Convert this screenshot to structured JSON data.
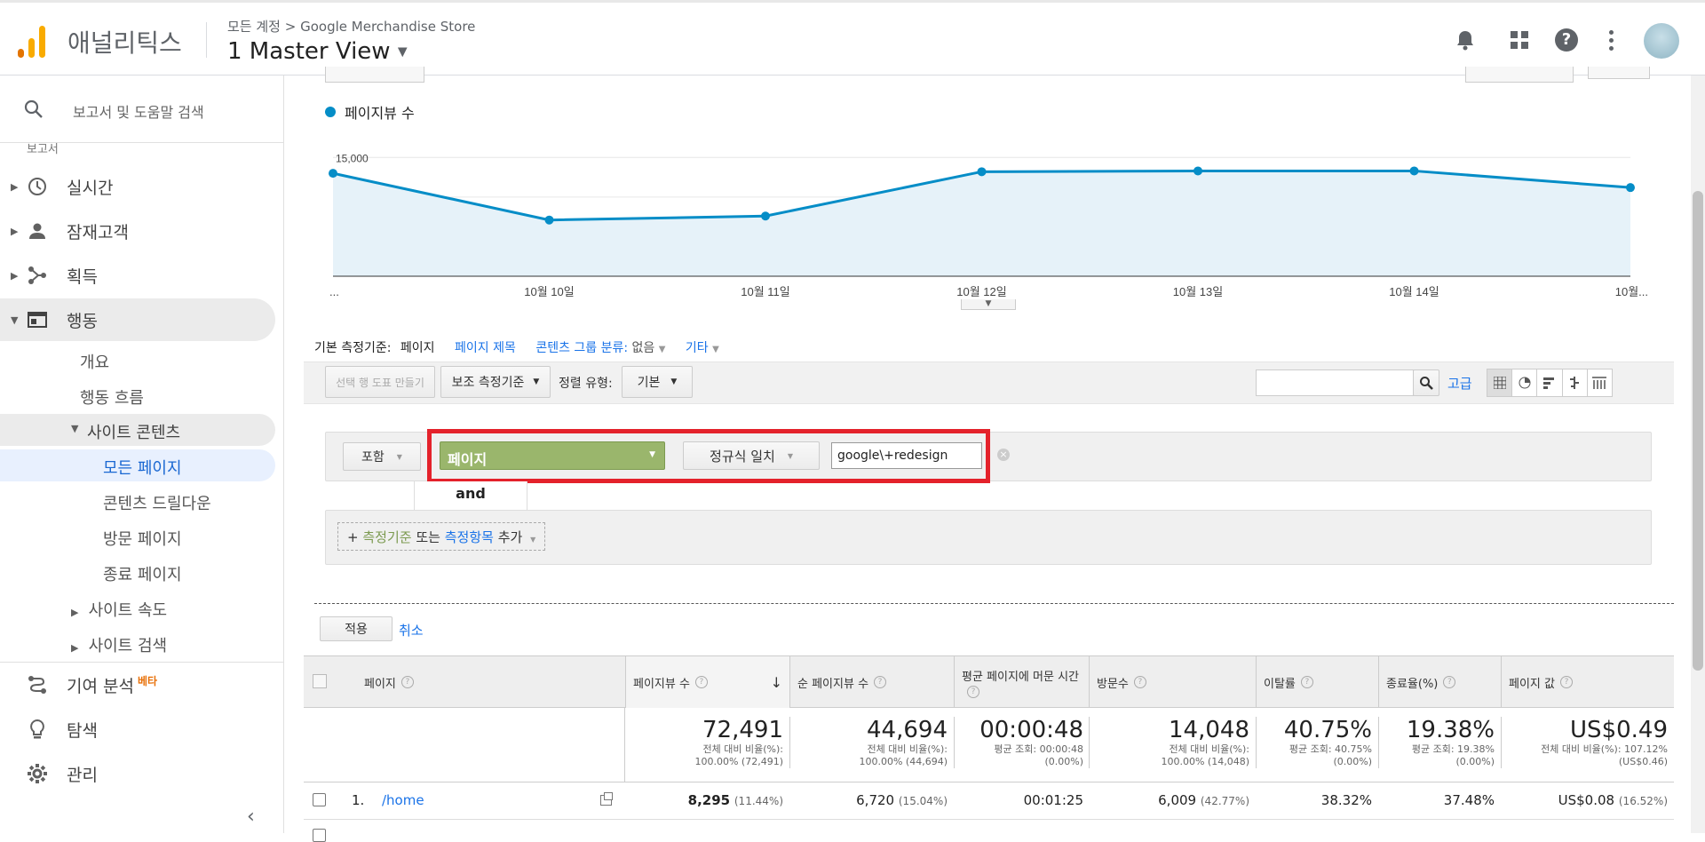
{
  "header": {
    "app_name": "애널리틱스",
    "breadcrumb_account": "모든 계정",
    "breadcrumb_separator": ">",
    "breadcrumb_property": "Google Merchandise Store",
    "view_name": "1 Master View"
  },
  "sidebar": {
    "search_placeholder": "보고서 및 도움말 검색",
    "section_label": "보고서",
    "items": [
      {
        "label": "실시간",
        "icon": "clock-icon"
      },
      {
        "label": "잠재고객",
        "icon": "person-icon"
      },
      {
        "label": "획득",
        "icon": "acquisition-icon"
      },
      {
        "label": "행동",
        "icon": "behavior-icon"
      }
    ],
    "behavior_sub": [
      "개요",
      "행동 흐름"
    ],
    "site_content": "사이트 콘텐츠",
    "site_content_sub": [
      "모든 페이지",
      "콘텐츠 드릴다운",
      "방문 페이지",
      "종료 페이지"
    ],
    "site_speed": "사이트 속도",
    "site_search": "사이트 검색",
    "attribution": "기여 분석",
    "attribution_badge": "베타",
    "discover": "탐색",
    "admin": "관리"
  },
  "chart": {
    "legend_label": "페이지뷰 수",
    "series_color": "#058dc7"
  },
  "chart_data": {
    "type": "line",
    "x": [
      "...",
      "10월 10일",
      "10월 11일",
      "10월 12일",
      "10월 13일",
      "10월 14일",
      "10월..."
    ],
    "series": [
      {
        "name": "페이지뷰 수",
        "values": [
          13000,
          7100,
          7600,
          13200,
          13300,
          13300,
          11200
        ]
      }
    ],
    "y_ticks": [
      "15,000",
      "10,000",
      "5,000"
    ],
    "ylim": [
      0,
      17500
    ]
  },
  "dimension_bar": {
    "label": "기본 측정기준:",
    "active": "페이지",
    "option_title": "페이지 제목",
    "option_group": "콘텐츠 그룹 분류:",
    "option_group_value": "없음",
    "option_other": "기타"
  },
  "toolbar": {
    "create_chart": "선택 행 도표 만들기",
    "secondary_dim": "보조 측정기준",
    "sort_label": "정렬 유형:",
    "sort_value": "기본",
    "advanced": "고급"
  },
  "filter": {
    "include": "포함",
    "dimension": "페이지",
    "match_type": "정규식 일치",
    "value": "google\\+redesign",
    "and_label": "and",
    "add_prefix": "+",
    "add_dimension": "측정기준",
    "add_or": "또는",
    "add_metric": "측정항목",
    "add_suffix": "추가",
    "apply": "적용",
    "cancel": "취소"
  },
  "table": {
    "headers": [
      "페이지",
      "페이지뷰 수",
      "순 페이지뷰 수",
      "평균 페이지에 머문 시간",
      "방문수",
      "이탈률",
      "종료율(%)",
      "페이지 값"
    ],
    "totals": [
      {
        "big": "72,491",
        "sub1": "전체 대비 비율(%):",
        "sub2": "100.00% (72,491)"
      },
      {
        "big": "44,694",
        "sub1": "전체 대비 비율(%):",
        "sub2": "100.00% (44,694)"
      },
      {
        "big": "00:00:48",
        "sub1": "평균 조회: 00:00:48",
        "sub2": "(0.00%)"
      },
      {
        "big": "14,048",
        "sub1": "전체 대비 비율(%):",
        "sub2": "100.00% (14,048)"
      },
      {
        "big": "40.75%",
        "sub1": "평균 조회: 40.75%",
        "sub2": "(0.00%)"
      },
      {
        "big": "19.38%",
        "sub1": "평균 조회: 19.38%",
        "sub2": "(0.00%)"
      },
      {
        "big": "US$0.49",
        "sub1": "전체 대비 비율(%): 107.12%",
        "sub2": "(US$0.46)"
      }
    ],
    "rows": [
      {
        "num": "1.",
        "page": "/home",
        "pageviews": "8,295",
        "pageviews_pct": "(11.44%)",
        "unique": "6,720",
        "unique_pct": "(15.04%)",
        "time": "00:01:25",
        "entrances": "6,009",
        "entrances_pct": "(42.77%)",
        "bounce": "38.32%",
        "exit": "37.48%",
        "value": "US$0.08",
        "value_pct": "(16.52%)"
      }
    ]
  }
}
